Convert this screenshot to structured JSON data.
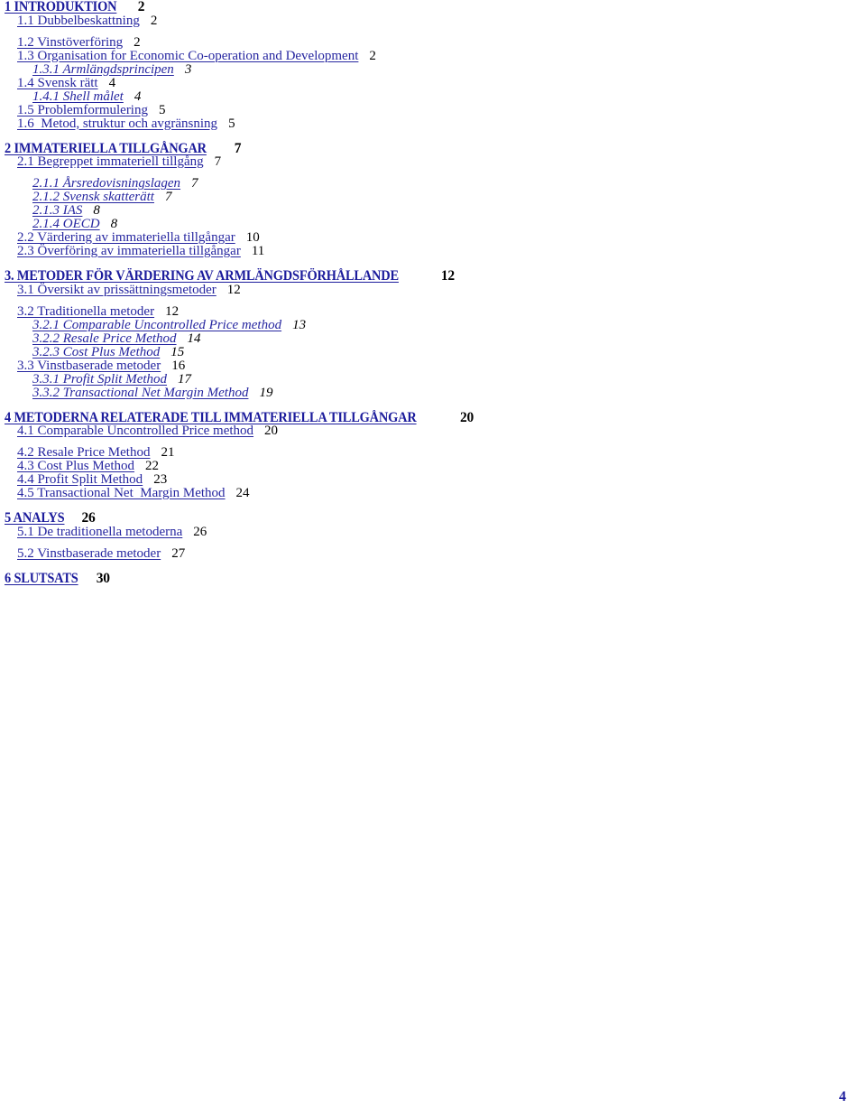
{
  "document": {
    "type": "table-of-contents",
    "language": "sv",
    "footer_page_number": "4",
    "colors": {
      "heading_link": "#1c1c9c",
      "entry_link": "#2626a0",
      "page_number": "#000000",
      "background": "#ffffff"
    }
  },
  "entries": [
    {
      "level": 1,
      "number": "1",
      "label": "1 INTRODUKTION",
      "page": "2"
    },
    {
      "level": 2,
      "number": "1.1",
      "label": "1.1 Dubbelbeskattning",
      "page": "2"
    },
    {
      "level": 2,
      "number": "1.2",
      "label": "1.2 Vinstöverföring",
      "page": "2"
    },
    {
      "level": 2,
      "number": "1.3",
      "label": "1.3 Organisation for Economic Co-operation and Development",
      "page": "2"
    },
    {
      "level": 3,
      "number": "1.3.1",
      "label": "1.3.1 Armlängdsprincipen",
      "page": "3"
    },
    {
      "level": 2,
      "number": "1.4",
      "label": "1.4 Svensk rätt",
      "page": "4"
    },
    {
      "level": 3,
      "number": "1.4.1",
      "label": "1.4.1 Shell målet",
      "page": "4"
    },
    {
      "level": 2,
      "number": "1.5",
      "label": "1.5 Problemformulering",
      "page": "5"
    },
    {
      "level": 2,
      "number": "1.6",
      "label": "1.6  Metod, struktur och avgränsning",
      "page": "5"
    },
    {
      "level": 1,
      "number": "2",
      "label": "2 IMMATERIELLA TILLGÅNGAR",
      "page": "7"
    },
    {
      "level": 2,
      "number": "2.1",
      "label": "2.1 Begreppet immateriell tillgång",
      "page": "7"
    },
    {
      "level": 3,
      "number": "2.1.1",
      "label": "2.1.1 Årsredovisningslagen",
      "page": "7"
    },
    {
      "level": 3,
      "number": "2.1.2",
      "label": "2.1.2 Svensk skatterätt",
      "page": "7"
    },
    {
      "level": 3,
      "number": "2.1.3",
      "label": "2.1.3 IAS",
      "page": "8"
    },
    {
      "level": 3,
      "number": "2.1.4",
      "label": "2.1.4 OECD",
      "page": "8"
    },
    {
      "level": 2,
      "number": "2.2",
      "label": "2.2 Värdering av immateriella tillgångar",
      "page": "10"
    },
    {
      "level": 2,
      "number": "2.3",
      "label": "2.3 Överföring av immateriella tillgångar",
      "page": "11"
    },
    {
      "level": 1,
      "number": "3.",
      "label": "3. METODER FÖR VÄRDERING AV ARMLÄNGDSFÖRHÅLLANDE",
      "page": "12"
    },
    {
      "level": 2,
      "number": "3.1",
      "label": "3.1 Översikt av prissättningsmetoder",
      "page": "12"
    },
    {
      "level": 2,
      "number": "3.2",
      "label": "3.2 Traditionella metoder",
      "page": "12"
    },
    {
      "level": 3,
      "number": "3.2.1",
      "label": "3.2.1 Comparable Uncontrolled Price method",
      "page": "13"
    },
    {
      "level": 3,
      "number": "3.2.2",
      "label": "3.2.2 Resale Price Method",
      "page": "14"
    },
    {
      "level": 3,
      "number": "3.2.3",
      "label": "3.2.3 Cost Plus Method",
      "page": "15"
    },
    {
      "level": 2,
      "number": "3.3",
      "label": "3.3 Vinstbaserade metoder",
      "page": "16"
    },
    {
      "level": 3,
      "number": "3.3.1",
      "label": "3.3.1 Profit Split Method",
      "page": "17"
    },
    {
      "level": 3,
      "number": "3.3.2",
      "label": "3.3.2 Transactional Net Margin Method",
      "page": "19"
    },
    {
      "level": 1,
      "number": "4",
      "label": "4 METODERNA RELATERADE TILL IMMATERIELLA TILLGÅNGAR",
      "page": "20"
    },
    {
      "level": 2,
      "number": "4.1",
      "label": "4.1 Comparable Uncontrolled Price method",
      "page": "20"
    },
    {
      "level": 2,
      "number": "4.2",
      "label": "4.2 Resale Price Method",
      "page": "21"
    },
    {
      "level": 2,
      "number": "4.3",
      "label": "4.3 Cost Plus Method",
      "page": "22"
    },
    {
      "level": 2,
      "number": "4.4",
      "label": "4.4 Profit Split Method",
      "page": "23"
    },
    {
      "level": 2,
      "number": "4.5",
      "label": "4.5 Transactional Net  Margin Method",
      "page": "24"
    },
    {
      "level": 1,
      "number": "5",
      "label": "5 ANALYS",
      "page": "26"
    },
    {
      "level": 2,
      "number": "5.1",
      "label": "5.1 De traditionella metoderna",
      "page": "26"
    },
    {
      "level": 2,
      "number": "5.2",
      "label": "5.2 Vinstbaserade metoder",
      "page": "27"
    },
    {
      "level": 1,
      "number": "6",
      "label": "6 SLUTSATS",
      "page": "30"
    }
  ]
}
